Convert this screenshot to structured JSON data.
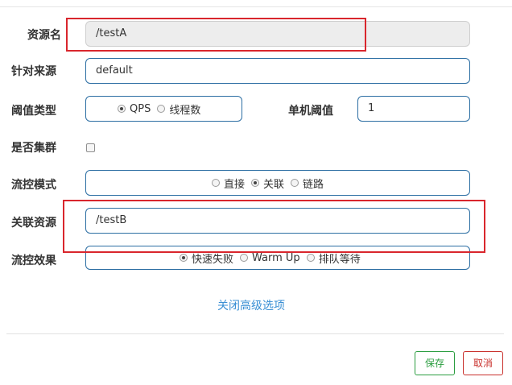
{
  "form": {
    "resource_name": {
      "label": "资源名",
      "value": "/testA"
    },
    "limit_app": {
      "label": "针对来源",
      "value": "default"
    },
    "threshold_type": {
      "label": "阈值类型",
      "options": [
        "QPS",
        "线程数"
      ],
      "selected": "QPS"
    },
    "single_threshold": {
      "label": "单机阈值",
      "value": "1"
    },
    "cluster_mode": {
      "label": "是否集群",
      "checked": false
    },
    "flow_mode": {
      "label": "流控模式",
      "options": [
        "直接",
        "关联",
        "链路"
      ],
      "selected": "关联"
    },
    "ref_resource": {
      "label": "关联资源",
      "value": "/testB"
    },
    "flow_effect": {
      "label": "流控效果",
      "options": [
        "快速失败",
        "Warm Up",
        "排队等待"
      ],
      "selected": "快速失败"
    }
  },
  "advanced_toggle": "关闭高级选项",
  "buttons": {
    "save": "保存",
    "cancel": "取消"
  },
  "colors": {
    "highlight_box": "#d9262d",
    "input_border": "#2c6ea3",
    "save": "#2a9d3f",
    "cancel": "#c9302c",
    "link": "#3a8fd4"
  }
}
